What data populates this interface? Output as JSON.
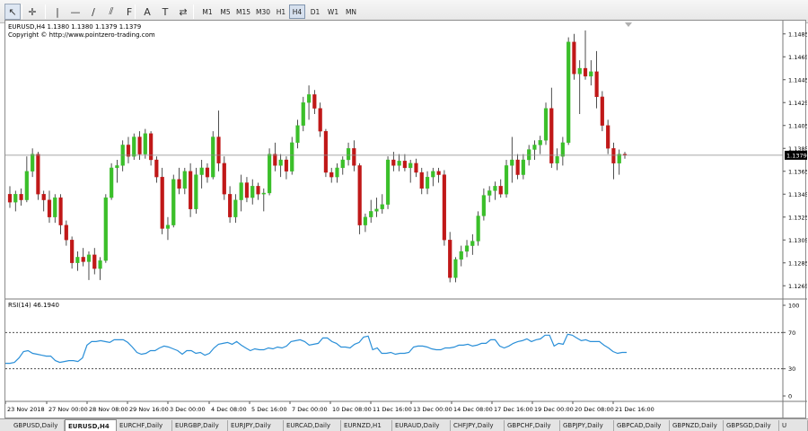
{
  "toolbar": {
    "tools": [
      {
        "name": "cursor-icon",
        "glyph": "↖",
        "active": true
      },
      {
        "name": "crosshair-icon",
        "glyph": "✛",
        "active": false
      },
      {
        "name": "vertical-line-icon",
        "glyph": "|",
        "active": false
      },
      {
        "name": "horizontal-line-icon",
        "glyph": "—",
        "active": false
      },
      {
        "name": "trendline-icon",
        "glyph": "∕",
        "active": false
      },
      {
        "name": "channel-icon",
        "glyph": "⫽",
        "active": false
      },
      {
        "name": "fibonacci-icon",
        "glyph": "F",
        "active": false
      },
      {
        "name": "text-icon",
        "glyph": "A",
        "active": false
      },
      {
        "name": "label-icon",
        "glyph": "T",
        "active": false
      },
      {
        "name": "arrows-icon",
        "glyph": "⇄",
        "active": false
      }
    ],
    "timeframes": [
      "M1",
      "M5",
      "M15",
      "M30",
      "H1",
      "H4",
      "D1",
      "W1",
      "MN"
    ],
    "active_timeframe": "H4"
  },
  "chart": {
    "symbol_line": "EURUSD,H4  1.1380 1.1380 1.1379 1.1379",
    "copyright": "Copyright © http://www.pointzero-trading.com",
    "current_price_label": "1.1379",
    "rsi_label": "RSI(14) 46.1940",
    "up_color": "#3bbf2a",
    "down_color": "#c01818",
    "rsi_color": "#2a8fd8"
  },
  "chart_data": [
    {
      "type": "candlestick",
      "title": "EURUSD,H4",
      "ylim": [
        1.1255,
        1.1495
      ],
      "y_ticks": [
        "1.1485",
        "1.1465",
        "1.1445",
        "1.1425",
        "1.1405",
        "1.1385",
        "1.1365",
        "1.1345",
        "1.1325",
        "1.1305",
        "1.1285",
        "1.1265"
      ],
      "current_price": 1.1379,
      "x_tick_labels": [
        "23 Nov 2018",
        "27 Nov 00:00",
        "28 Nov 08:00",
        "29 Nov 16:00",
        "3 Dec 00:00",
        "4 Dec 08:00",
        "5 Dec 16:00",
        "7 Dec 00:00",
        "10 Dec 08:00",
        "11 Dec 16:00",
        "13 Dec 00:00",
        "14 Dec 08:00",
        "17 Dec 16:00",
        "19 Dec 00:00",
        "20 Dec 08:00",
        "21 Dec 16:00"
      ],
      "ohlc": [
        [
          1.1345,
          1.1352,
          1.1333,
          1.1338
        ],
        [
          1.1338,
          1.1348,
          1.133,
          1.1345
        ],
        [
          1.1345,
          1.135,
          1.1335,
          1.134
        ],
        [
          1.134,
          1.1378,
          1.1338,
          1.1365
        ],
        [
          1.1365,
          1.1385,
          1.136,
          1.138
        ],
        [
          1.138,
          1.1382,
          1.134,
          1.1345
        ],
        [
          1.1345,
          1.1348,
          1.133,
          1.134
        ],
        [
          1.134,
          1.1348,
          1.132,
          1.1325
        ],
        [
          1.1325,
          1.1345,
          1.132,
          1.1342
        ],
        [
          1.1342,
          1.1345,
          1.131,
          1.1318
        ],
        [
          1.1318,
          1.1322,
          1.13,
          1.1305
        ],
        [
          1.1305,
          1.1308,
          1.128,
          1.1285
        ],
        [
          1.1285,
          1.1295,
          1.1278,
          1.129
        ],
        [
          1.129,
          1.1298,
          1.1282,
          1.1286
        ],
        [
          1.1286,
          1.1295,
          1.127,
          1.1292
        ],
        [
          1.1292,
          1.1298,
          1.1275,
          1.128
        ],
        [
          1.128,
          1.129,
          1.127,
          1.1287
        ],
        [
          1.1287,
          1.1345,
          1.1285,
          1.1342
        ],
        [
          1.1342,
          1.1372,
          1.134,
          1.1368
        ],
        [
          1.1368,
          1.1375,
          1.1355,
          1.137
        ],
        [
          1.137,
          1.1392,
          1.1365,
          1.1388
        ],
        [
          1.1388,
          1.1395,
          1.1372,
          1.1378
        ],
        [
          1.1378,
          1.1398,
          1.1375,
          1.1395
        ],
        [
          1.1395,
          1.14,
          1.1375,
          1.138
        ],
        [
          1.138,
          1.1402,
          1.1376,
          1.1398
        ],
        [
          1.1398,
          1.14,
          1.137,
          1.1375
        ],
        [
          1.1375,
          1.1378,
          1.1355,
          1.136
        ],
        [
          1.136,
          1.1368,
          1.131,
          1.1315
        ],
        [
          1.1315,
          1.1325,
          1.1305,
          1.1318
        ],
        [
          1.1318,
          1.1362,
          1.1316,
          1.1358
        ],
        [
          1.1358,
          1.1368,
          1.1345,
          1.135
        ],
        [
          1.135,
          1.1368,
          1.1345,
          1.1365
        ],
        [
          1.1365,
          1.1372,
          1.1325,
          1.1332
        ],
        [
          1.1332,
          1.1368,
          1.1328,
          1.1362
        ],
        [
          1.1362,
          1.1375,
          1.135,
          1.1368
        ],
        [
          1.1368,
          1.1372,
          1.1355,
          1.136
        ],
        [
          1.136,
          1.14,
          1.1358,
          1.1395
        ],
        [
          1.1395,
          1.1418,
          1.1365,
          1.1372
        ],
        [
          1.1372,
          1.1378,
          1.134,
          1.1345
        ],
        [
          1.1345,
          1.1352,
          1.132,
          1.1325
        ],
        [
          1.1325,
          1.1345,
          1.132,
          1.134
        ],
        [
          1.134,
          1.1362,
          1.133,
          1.1355
        ],
        [
          1.1355,
          1.136,
          1.1338,
          1.1342
        ],
        [
          1.1342,
          1.1358,
          1.1336,
          1.1352
        ],
        [
          1.1352,
          1.1355,
          1.134,
          1.1345
        ],
        [
          1.1345,
          1.135,
          1.133,
          1.1346
        ],
        [
          1.1346,
          1.1385,
          1.1344,
          1.138
        ],
        [
          1.138,
          1.139,
          1.1365,
          1.137
        ],
        [
          1.137,
          1.138,
          1.136,
          1.1375
        ],
        [
          1.1375,
          1.1378,
          1.1358,
          1.1365
        ],
        [
          1.1365,
          1.1395,
          1.1362,
          1.139
        ],
        [
          1.139,
          1.141,
          1.1385,
          1.1405
        ],
        [
          1.1405,
          1.143,
          1.14,
          1.1425
        ],
        [
          1.1425,
          1.144,
          1.141,
          1.1432
        ],
        [
          1.1432,
          1.1436,
          1.1415,
          1.142
        ],
        [
          1.142,
          1.1425,
          1.1395,
          1.14
        ],
        [
          1.14,
          1.1402,
          1.136,
          1.1364
        ],
        [
          1.1364,
          1.1368,
          1.1355,
          1.136
        ],
        [
          1.136,
          1.1372,
          1.1355,
          1.1368
        ],
        [
          1.1368,
          1.1378,
          1.1362,
          1.1375
        ],
        [
          1.1375,
          1.139,
          1.137,
          1.1385
        ],
        [
          1.1385,
          1.1392,
          1.1365,
          1.137
        ],
        [
          1.137,
          1.1372,
          1.131,
          1.1318
        ],
        [
          1.1318,
          1.1328,
          1.1312,
          1.1325
        ],
        [
          1.1325,
          1.134,
          1.132,
          1.133
        ],
        [
          1.133,
          1.1342,
          1.1325,
          1.1332
        ],
        [
          1.1332,
          1.1345,
          1.1328,
          1.1336
        ],
        [
          1.1336,
          1.1378,
          1.1332,
          1.1375
        ],
        [
          1.1375,
          1.1382,
          1.1365,
          1.137
        ],
        [
          1.137,
          1.138,
          1.1365,
          1.1374
        ],
        [
          1.1374,
          1.138,
          1.1365,
          1.1368
        ],
        [
          1.1368,
          1.1375,
          1.1355,
          1.1372
        ],
        [
          1.1372,
          1.1376,
          1.136,
          1.1364
        ],
        [
          1.1364,
          1.1368,
          1.1345,
          1.135
        ],
        [
          1.135,
          1.1365,
          1.1345,
          1.136
        ],
        [
          1.136,
          1.1368,
          1.1352,
          1.1365
        ],
        [
          1.1365,
          1.1368,
          1.1355,
          1.1362
        ],
        [
          1.1362,
          1.1366,
          1.13,
          1.1305
        ],
        [
          1.1305,
          1.1312,
          1.1268,
          1.1272
        ],
        [
          1.1272,
          1.129,
          1.1268,
          1.1288
        ],
        [
          1.1288,
          1.13,
          1.1282,
          1.1295
        ],
        [
          1.1295,
          1.1305,
          1.129,
          1.13
        ],
        [
          1.13,
          1.131,
          1.1292,
          1.1304
        ],
        [
          1.1304,
          1.133,
          1.13,
          1.1326
        ],
        [
          1.1326,
          1.135,
          1.1322,
          1.1344
        ],
        [
          1.1344,
          1.1352,
          1.1338,
          1.1348
        ],
        [
          1.1348,
          1.1356,
          1.134,
          1.1352
        ],
        [
          1.1352,
          1.1358,
          1.1342,
          1.1345
        ],
        [
          1.1345,
          1.1375,
          1.1342,
          1.137
        ],
        [
          1.137,
          1.1395,
          1.1355,
          1.1375
        ],
        [
          1.1375,
          1.138,
          1.1358,
          1.1362
        ],
        [
          1.1362,
          1.138,
          1.1358,
          1.1375
        ],
        [
          1.1375,
          1.1388,
          1.137,
          1.1384
        ],
        [
          1.1384,
          1.1392,
          1.1375,
          1.1388
        ],
        [
          1.1388,
          1.1396,
          1.138,
          1.1392
        ],
        [
          1.1392,
          1.1425,
          1.1388,
          1.142
        ],
        [
          1.142,
          1.1438,
          1.1368,
          1.1372
        ],
        [
          1.1372,
          1.1385,
          1.1366,
          1.1378
        ],
        [
          1.1378,
          1.1395,
          1.137,
          1.139
        ],
        [
          1.139,
          1.1482,
          1.1388,
          1.1478
        ],
        [
          1.1478,
          1.1485,
          1.1445,
          1.145
        ],
        [
          1.145,
          1.1462,
          1.1415,
          1.1455
        ],
        [
          1.1455,
          1.1488,
          1.1445,
          1.1448
        ],
        [
          1.1448,
          1.1462,
          1.144,
          1.1452
        ],
        [
          1.1452,
          1.147,
          1.142,
          1.143
        ],
        [
          1.143,
          1.1435,
          1.14,
          1.1405
        ],
        [
          1.1405,
          1.141,
          1.138,
          1.1385
        ],
        [
          1.1385,
          1.139,
          1.1358,
          1.1372
        ],
        [
          1.1372,
          1.1384,
          1.1362,
          1.138
        ],
        [
          1.138,
          1.1382,
          1.1376,
          1.1379
        ]
      ]
    },
    {
      "type": "line",
      "title": "RSI(14) 46.1940",
      "ylim": [
        0,
        100
      ],
      "y_ticks": [
        "100",
        "70",
        "30",
        "0"
      ],
      "levels": [
        70,
        30
      ],
      "series": [
        {
          "name": "RSI(14)",
          "values": [
            36,
            36,
            37,
            42,
            49,
            50,
            47,
            46,
            45,
            44,
            44,
            39,
            37,
            38,
            39,
            39,
            38,
            42,
            56,
            60,
            60,
            61,
            60,
            59,
            62,
            62,
            62,
            59,
            54,
            48,
            46,
            47,
            50,
            50,
            53,
            55,
            54,
            52,
            50,
            46,
            50,
            50,
            47,
            48,
            45,
            47,
            53,
            57,
            58,
            59,
            57,
            60,
            56,
            53,
            50,
            52,
            51,
            51,
            53,
            52,
            54,
            53,
            55,
            60,
            61,
            62,
            60,
            56,
            57,
            58,
            64,
            64,
            60,
            58,
            54,
            54,
            53,
            57,
            59,
            65,
            66,
            51,
            53,
            47,
            47,
            48,
            46,
            47,
            47,
            48,
            54,
            55,
            55,
            54,
            52,
            51,
            51,
            53,
            53,
            54,
            56,
            56,
            57,
            55,
            56,
            58,
            58,
            62,
            62,
            55,
            53,
            55,
            58,
            60,
            61,
            63,
            60,
            62,
            63,
            67,
            67,
            55,
            58,
            57,
            68,
            67,
            64,
            61,
            62,
            60,
            60,
            60,
            56,
            53,
            49,
            47,
            48,
            48
          ]
        }
      ]
    }
  ],
  "tabs": [
    {
      "label": "GBPUSD,Daily",
      "active": false
    },
    {
      "label": "EURUSD,H4",
      "active": true
    },
    {
      "label": "EURCHF,Daily",
      "active": false
    },
    {
      "label": "EURGBP,Daily",
      "active": false
    },
    {
      "label": "EURJPY,Daily",
      "active": false
    },
    {
      "label": "EURCAD,Daily",
      "active": false
    },
    {
      "label": "EURNZD,H1",
      "active": false
    },
    {
      "label": "EURAUD,Daily",
      "active": false
    },
    {
      "label": "CHFJPY,Daily",
      "active": false
    },
    {
      "label": "GBPCHF,Daily",
      "active": false
    },
    {
      "label": "GBPJPY,Daily",
      "active": false
    },
    {
      "label": "GBPCAD,Daily",
      "active": false
    },
    {
      "label": "GBPNZD,Daily",
      "active": false
    },
    {
      "label": "GBPSGD,Daily",
      "active": false
    },
    {
      "label": "U",
      "active": false
    }
  ]
}
